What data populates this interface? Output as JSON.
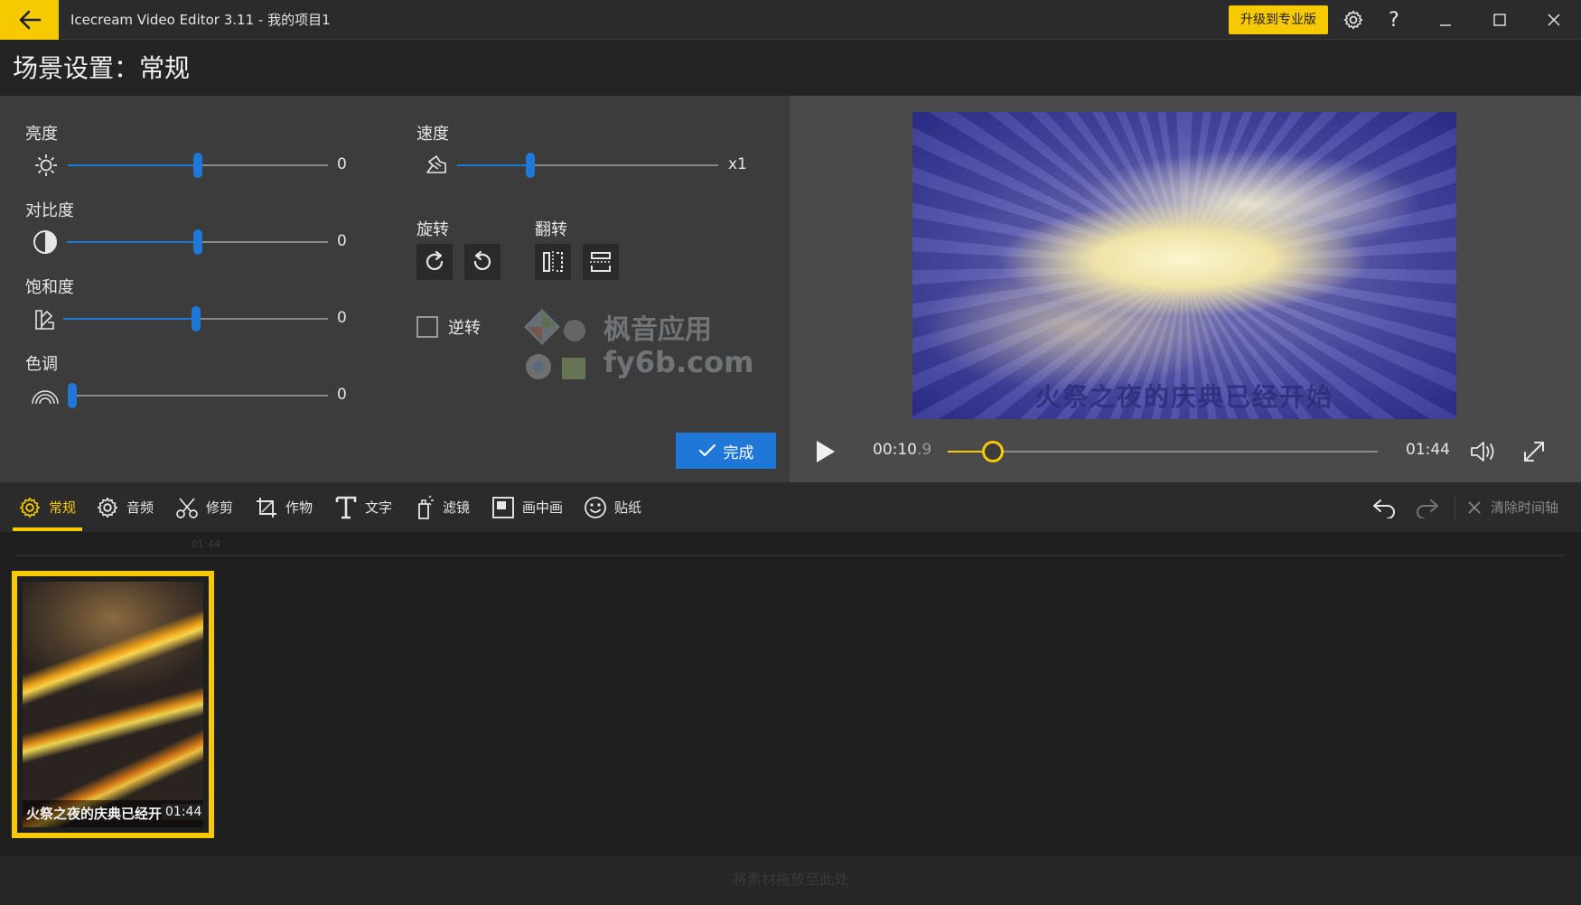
{
  "titlebar": {
    "app_title": "Icecream Video Editor 3.11   -   我的项目1",
    "upgrade_label": "升级到专业版",
    "help_label": "?"
  },
  "header": {
    "title": "场景设置：常规"
  },
  "settings": {
    "brightness": {
      "label": "亮度",
      "value": "0",
      "level": 0.5
    },
    "contrast": {
      "label": "对比度",
      "value": "0",
      "level": 0.5
    },
    "saturation": {
      "label": "饱和度",
      "value": "0",
      "level": 0.5
    },
    "hue": {
      "label": "色调",
      "value": "0",
      "level": 0.0
    },
    "speed": {
      "label": "速度",
      "value": "x1",
      "level": 0.28
    },
    "rotate_label": "旋转",
    "flip_label": "翻转",
    "reverse_label": "逆转",
    "done_label": "完成"
  },
  "watermark": {
    "line1": "枫音应用",
    "line2": "fy6b.com"
  },
  "preview": {
    "caption": "火祭之夜的庆典已经开始",
    "current_time": "00:10",
    "current_frac": ".9",
    "total_time": "01:44",
    "progress": 0.105
  },
  "tools": [
    {
      "label": "常规",
      "icon": "gear-icon",
      "active": true
    },
    {
      "label": "音频",
      "icon": "audio-gear-icon"
    },
    {
      "label": "修剪",
      "icon": "scissors-icon"
    },
    {
      "label": "作物",
      "icon": "crop-icon"
    },
    {
      "label": "文字",
      "icon": "text-icon"
    },
    {
      "label": "滤镜",
      "icon": "filter-icon"
    },
    {
      "label": "画中画",
      "icon": "pip-icon"
    },
    {
      "label": "贴纸",
      "icon": "sticker-icon"
    }
  ],
  "timeline": {
    "clear_label": "清除时间轴",
    "ruler_mark": "01:44",
    "clip_caption": "火祭之夜的庆典已经开始",
    "clip_duration": "01:44",
    "drop_hint": "将素材拖放至此处"
  },
  "colors": {
    "accent": "#f6c900",
    "blue": "#1f78d8"
  }
}
